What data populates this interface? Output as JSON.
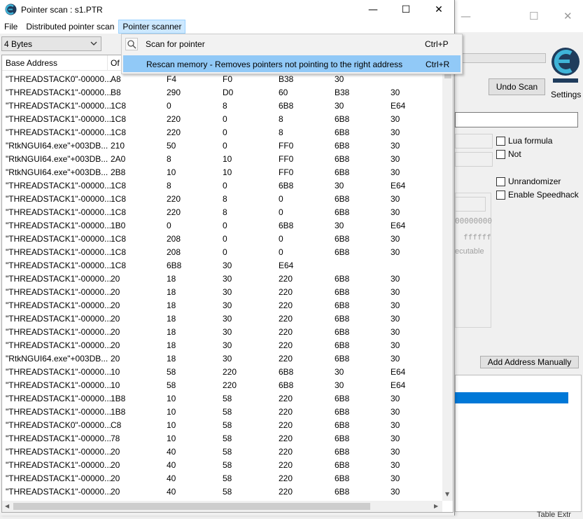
{
  "background_window": {
    "undo_scan": "Undo Scan",
    "settings": "Settings",
    "checkboxes": [
      "Lua formula",
      "Not",
      "Unrandomizer",
      "Enable Speedhack"
    ],
    "hex_text_1": "00000000",
    "hex_text_2": "ffffff",
    "executable_text": "ecutable",
    "add_address_manually": "Add Address Manually",
    "bottom_text": "Table Extr"
  },
  "pointer_scan": {
    "title": "Pointer scan : s1.PTR",
    "menu": [
      "File",
      "Distributed pointer scan",
      "Pointer scanner"
    ],
    "type_combo": "4 Bytes",
    "columns": [
      "Base Address",
      "Of"
    ],
    "rows": [
      [
        "\"THREADSTACK0\"-00000...",
        "A8",
        "F4",
        "F0",
        "B38",
        "30"
      ],
      [
        "\"THREADSTACK1\"-00000...",
        "B8",
        "290",
        "D0",
        "60",
        "B38",
        "30"
      ],
      [
        "\"THREADSTACK1\"-00000...",
        "1C8",
        "0",
        "8",
        "6B8",
        "30",
        "E64"
      ],
      [
        "\"THREADSTACK1\"-00000...",
        "1C8",
        "220",
        "0",
        "8",
        "6B8",
        "30"
      ],
      [
        "\"THREADSTACK1\"-00000...",
        "1C8",
        "220",
        "0",
        "8",
        "6B8",
        "30"
      ],
      [
        "\"RtkNGUI64.exe\"+003DB...",
        "210",
        "50",
        "0",
        "FF0",
        "6B8",
        "30"
      ],
      [
        "\"RtkNGUI64.exe\"+003DB...",
        "2A0",
        "8",
        "10",
        "FF0",
        "6B8",
        "30"
      ],
      [
        "\"RtkNGUI64.exe\"+003DB...",
        "2B8",
        "10",
        "10",
        "FF0",
        "6B8",
        "30"
      ],
      [
        "\"THREADSTACK1\"-00000...",
        "1C8",
        "8",
        "0",
        "6B8",
        "30",
        "E64"
      ],
      [
        "\"THREADSTACK1\"-00000...",
        "1C8",
        "220",
        "8",
        "0",
        "6B8",
        "30"
      ],
      [
        "\"THREADSTACK1\"-00000...",
        "1C8",
        "220",
        "8",
        "0",
        "6B8",
        "30"
      ],
      [
        "\"THREADSTACK1\"-00000...",
        "1B0",
        "0",
        "0",
        "6B8",
        "30",
        "E64"
      ],
      [
        "\"THREADSTACK1\"-00000...",
        "1C8",
        "208",
        "0",
        "0",
        "6B8",
        "30"
      ],
      [
        "\"THREADSTACK1\"-00000...",
        "1C8",
        "208",
        "0",
        "0",
        "6B8",
        "30"
      ],
      [
        "\"THREADSTACK1\"-00000...",
        "1C8",
        "6B8",
        "30",
        "E64",
        "",
        ""
      ],
      [
        "\"THREADSTACK1\"-00000...",
        "20",
        "18",
        "30",
        "220",
        "6B8",
        "30"
      ],
      [
        "\"THREADSTACK1\"-00000...",
        "20",
        "18",
        "30",
        "220",
        "6B8",
        "30"
      ],
      [
        "\"THREADSTACK1\"-00000...",
        "20",
        "18",
        "30",
        "220",
        "6B8",
        "30"
      ],
      [
        "\"THREADSTACK1\"-00000...",
        "20",
        "18",
        "30",
        "220",
        "6B8",
        "30"
      ],
      [
        "\"THREADSTACK1\"-00000...",
        "20",
        "18",
        "30",
        "220",
        "6B8",
        "30"
      ],
      [
        "\"THREADSTACK1\"-00000...",
        "20",
        "18",
        "30",
        "220",
        "6B8",
        "30"
      ],
      [
        "\"RtkNGUI64.exe\"+003DB...",
        "20",
        "18",
        "30",
        "220",
        "6B8",
        "30"
      ],
      [
        "\"THREADSTACK1\"-00000...",
        "10",
        "58",
        "220",
        "6B8",
        "30",
        "E64"
      ],
      [
        "\"THREADSTACK1\"-00000...",
        "10",
        "58",
        "220",
        "6B8",
        "30",
        "E64"
      ],
      [
        "\"THREADSTACK1\"-00000...",
        "1B8",
        "10",
        "58",
        "220",
        "6B8",
        "30"
      ],
      [
        "\"THREADSTACK1\"-00000...",
        "1B8",
        "10",
        "58",
        "220",
        "6B8",
        "30"
      ],
      [
        "\"THREADSTACK0\"-00000...",
        "C8",
        "10",
        "58",
        "220",
        "6B8",
        "30"
      ],
      [
        "\"THREADSTACK1\"-00000...",
        "78",
        "10",
        "58",
        "220",
        "6B8",
        "30"
      ],
      [
        "\"THREADSTACK1\"-00000...",
        "20",
        "40",
        "58",
        "220",
        "6B8",
        "30"
      ],
      [
        "\"THREADSTACK1\"-00000...",
        "20",
        "40",
        "58",
        "220",
        "6B8",
        "30"
      ],
      [
        "\"THREADSTACK1\"-00000...",
        "20",
        "40",
        "58",
        "220",
        "6B8",
        "30"
      ],
      [
        "\"THREADSTACK1\"-00000...",
        "20",
        "40",
        "58",
        "220",
        "6B8",
        "30"
      ]
    ]
  },
  "pointer_scanner_menu": {
    "items": [
      {
        "label": "Scan for pointer",
        "shortcut": "Ctrl+P"
      },
      {
        "label": "Rescan memory - Removes pointers not pointing to the right address",
        "shortcut": "Ctrl+R"
      }
    ],
    "selected_index": 1
  },
  "colors": {
    "selection_blue": "#0078d7",
    "menu_highlight": "#91c9f7",
    "active_menu_bg": "#cce8ff"
  }
}
